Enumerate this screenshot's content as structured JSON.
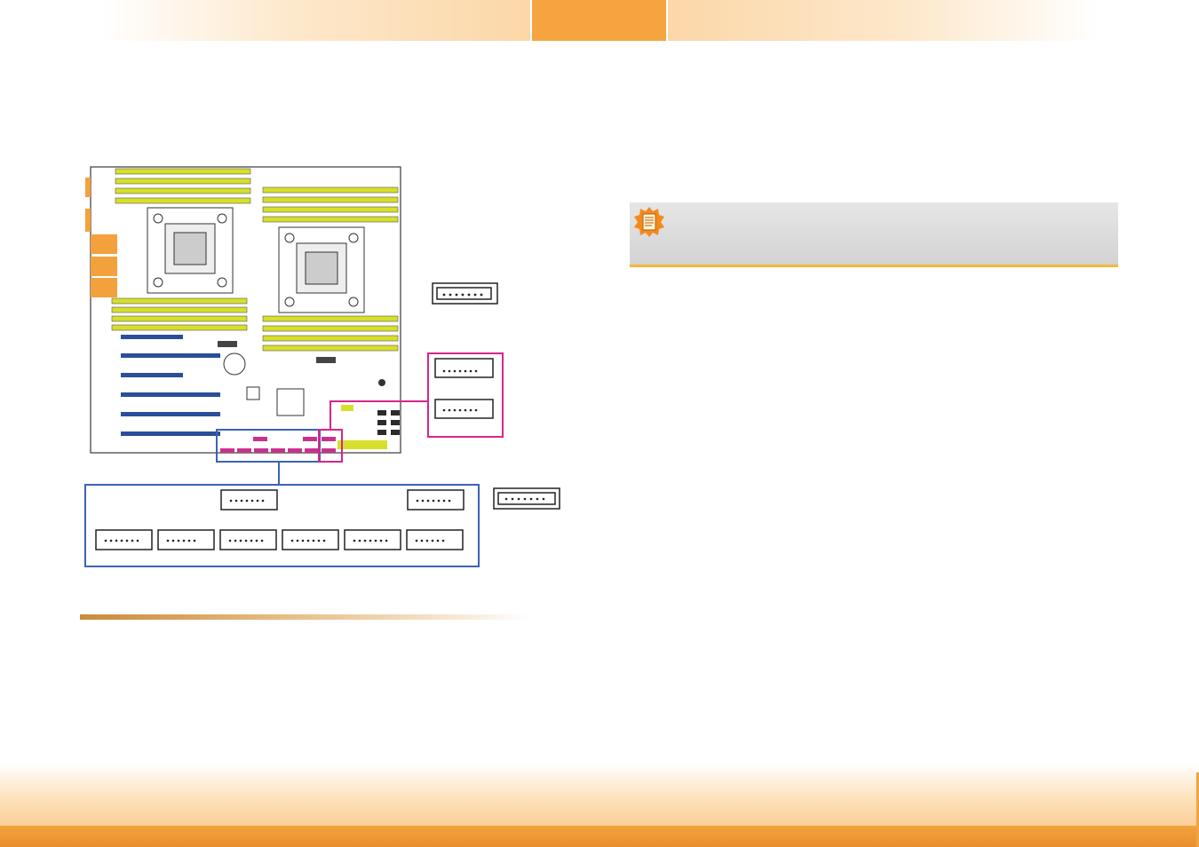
{
  "header": {
    "left_tab": "",
    "center_tab": "",
    "right_tab": ""
  },
  "diagram": {
    "board_colors": {
      "outline": "#3a3a3a",
      "memory_slot": "#d8df2a",
      "pcie_slot": "#2a4e9c",
      "sata_connector": "#c8328c",
      "rear_io": "#f3a13c",
      "blue_callout": "#3b63b3",
      "magenta_callout": "#d6258b"
    },
    "callouts": [
      {
        "name": "standalone-sata-top",
        "pins": 7
      },
      {
        "name": "magenta-group",
        "connectors": 2
      },
      {
        "name": "blue-group",
        "top_row": 2,
        "bottom_row": 6
      },
      {
        "name": "standalone-sata-side",
        "pins": 7
      }
    ]
  },
  "note": {
    "icon": "note-icon",
    "text": ""
  },
  "footer": {
    "page_number": ""
  }
}
